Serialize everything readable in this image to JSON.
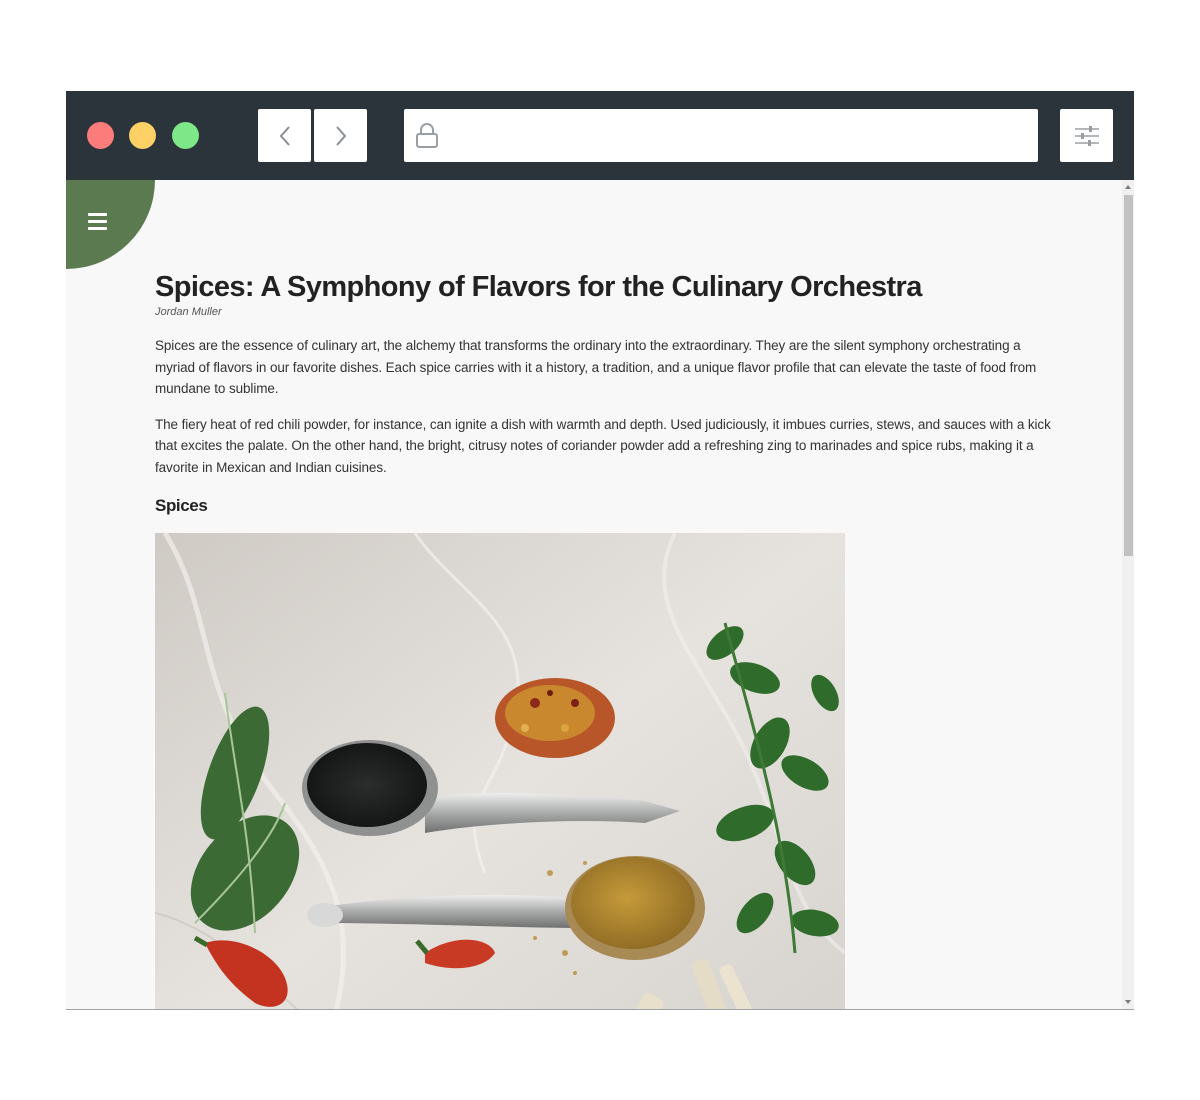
{
  "browser": {
    "window_colors": {
      "titlebar": "#2c343b",
      "close": "#fc7b7b",
      "minimize": "#fdd166",
      "maximize": "#7ee787"
    },
    "back_icon": "chevron-left-icon",
    "forward_icon": "chevron-right-icon",
    "lock_icon": "lock-icon",
    "settings_icon": "sliders-icon",
    "address": ""
  },
  "page": {
    "menu_icon": "hamburger-icon",
    "accent_color": "#5c7a4f",
    "title": "Spices: A Symphony of Flavors for the Culinary Orchestra",
    "author": "Jordan Muller",
    "paragraphs": [
      "Spices are the essence of culinary art, the alchemy that transforms the ordinary into the extraordinary. They are the silent symphony orchestrating a myriad of flavors in our favorite dishes. Each spice carries with it a history, a tradition, and a unique flavor profile that can elevate the taste of food from mundane to sublime.",
      "The fiery heat of red chili powder, for instance, can ignite a dish with warmth and depth. Used judiciously, it imbues curries, stews, and sauces with a kick that excites the palate. On the other hand, the bright, citrusy notes of coriander powder add a refreshing zing to marinades and spice rubs, making it a favorite in Mexican and Indian cuisines."
    ],
    "section_heading": "Spices"
  }
}
